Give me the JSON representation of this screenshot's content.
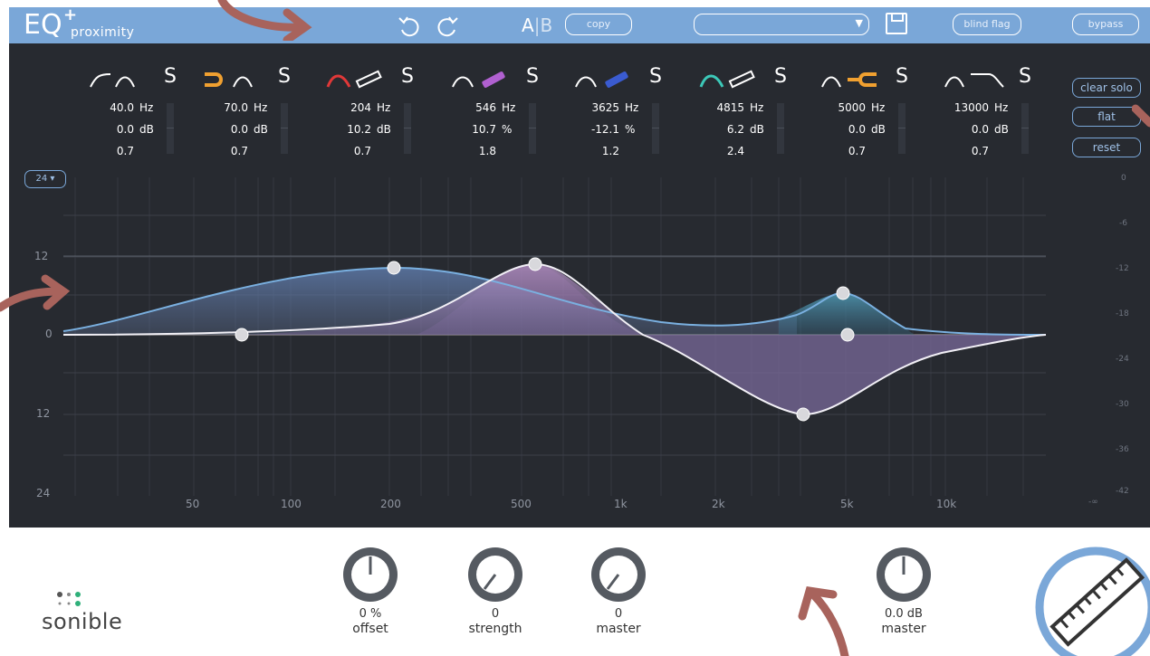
{
  "header": {
    "logo_text": "EQ",
    "logo_plus": "+",
    "product_name": "proximity",
    "undo_icon": "undo-icon",
    "redo_icon": "redo-icon",
    "ab_a": "A",
    "ab_b": "B",
    "copy_label": "copy",
    "preset_value": "",
    "blind_flag_label": "blind flag",
    "bypass_label": "bypass"
  },
  "bands": [
    {
      "freq": "40.0",
      "gain": "0.0",
      "q": "0.7",
      "gain_unit": "dB",
      "solo": "S",
      "color": "#ffffff"
    },
    {
      "freq": "70.0",
      "gain": "0.0",
      "q": "0.7",
      "gain_unit": "dB",
      "solo": "S",
      "color": "#f0a030"
    },
    {
      "freq": "204",
      "gain": "10.2",
      "q": "0.7",
      "gain_unit": "dB",
      "solo": "S",
      "color": "#e03838"
    },
    {
      "freq": "546",
      "gain": "10.7",
      "q": "1.8",
      "gain_unit": "%",
      "solo": "S",
      "color": "#b060d0"
    },
    {
      "freq": "3625",
      "gain": "-12.1",
      "q": "1.2",
      "gain_unit": "%",
      "solo": "S",
      "color": "#3a5bd0"
    },
    {
      "freq": "4815",
      "gain": "6.2",
      "q": "2.4",
      "gain_unit": "dB",
      "solo": "S",
      "color": "#3cc8b8"
    },
    {
      "freq": "5000",
      "gain": "0.0",
      "q": "0.7",
      "gain_unit": "dB",
      "solo": "S",
      "color": "#f0a030"
    },
    {
      "freq": "13000",
      "gain": "0.0",
      "q": "0.7",
      "gain_unit": "dB",
      "solo": "S",
      "color": "#ffffff"
    }
  ],
  "freq_unit": "Hz",
  "side_buttons": {
    "clear_solo": "clear solo",
    "flat": "flat",
    "reset": "reset"
  },
  "range_select": "24 ▾",
  "graph": {
    "left_axis": [
      "12",
      "0",
      "12",
      "24"
    ],
    "right_axis": [
      "0",
      "-6",
      "-12",
      "-18",
      "-24",
      "-30",
      "-36",
      "-42"
    ],
    "freq_axis": [
      "50",
      "100",
      "200",
      "500",
      "1k",
      "2k",
      "5k",
      "10k"
    ],
    "freq_axis_right": "-∞"
  },
  "bottom": {
    "brand": "sonible",
    "knobs": [
      {
        "value": "0 %",
        "label": "offset"
      },
      {
        "value": "0",
        "label": "strength"
      },
      {
        "value": "0",
        "label": "master"
      },
      {
        "value": "0.0 dB",
        "label": "master"
      }
    ]
  },
  "colors": {
    "accent": "#7aa7d8",
    "panel": "#272a30",
    "arrow": "#a8635c"
  }
}
